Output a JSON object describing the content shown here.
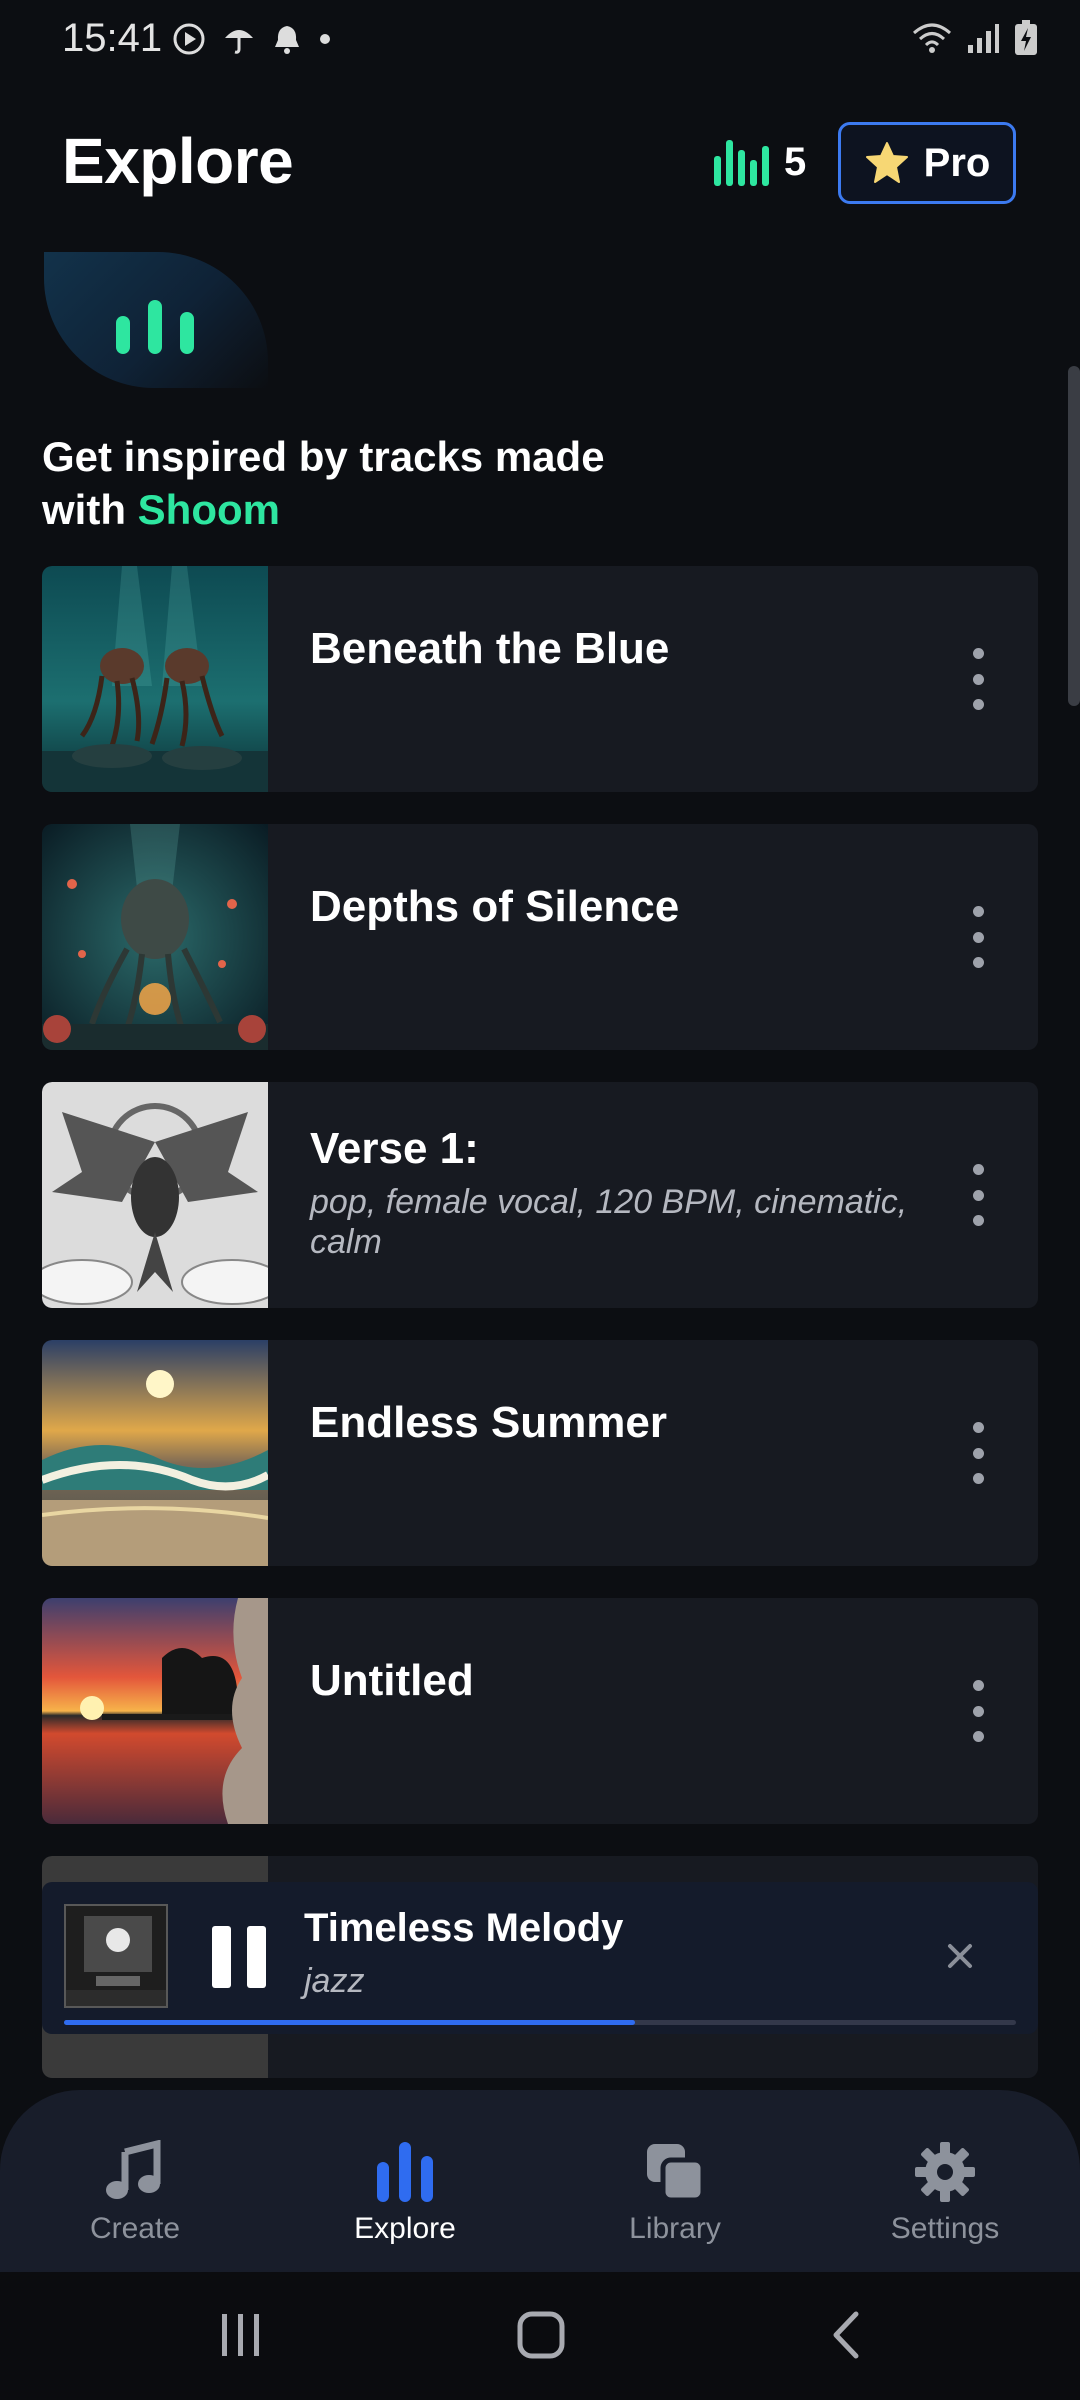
{
  "status_bar": {
    "time": "15:41"
  },
  "header": {
    "title": "Explore",
    "credits": "5",
    "pro_label": "Pro"
  },
  "intro": {
    "line1": "Get inspired by tracks made",
    "line2_prefix": "with ",
    "brand": "Shoom"
  },
  "tracks": [
    {
      "title": "Beneath the Blue",
      "subtitle": ""
    },
    {
      "title": "Depths of Silence",
      "subtitle": ""
    },
    {
      "title": "Verse 1:",
      "subtitle": "pop, female vocal, 120 BPM, cinematic, calm"
    },
    {
      "title": "Endless Summer",
      "subtitle": ""
    },
    {
      "title": "Untitled",
      "subtitle": ""
    }
  ],
  "player": {
    "title": "Timeless Melody",
    "genre": "jazz",
    "progress": 0.6
  },
  "nav": [
    {
      "label": "Create",
      "icon": "music-note-icon",
      "active": false
    },
    {
      "label": "Explore",
      "icon": "bars-icon",
      "active": true
    },
    {
      "label": "Library",
      "icon": "library-icon",
      "active": false
    },
    {
      "label": "Settings",
      "icon": "gear-icon",
      "active": false
    }
  ],
  "colors": {
    "accent_green": "#2ee6a0",
    "accent_blue": "#3c7af0",
    "background": "#0c0e12",
    "card": "#171a21"
  }
}
